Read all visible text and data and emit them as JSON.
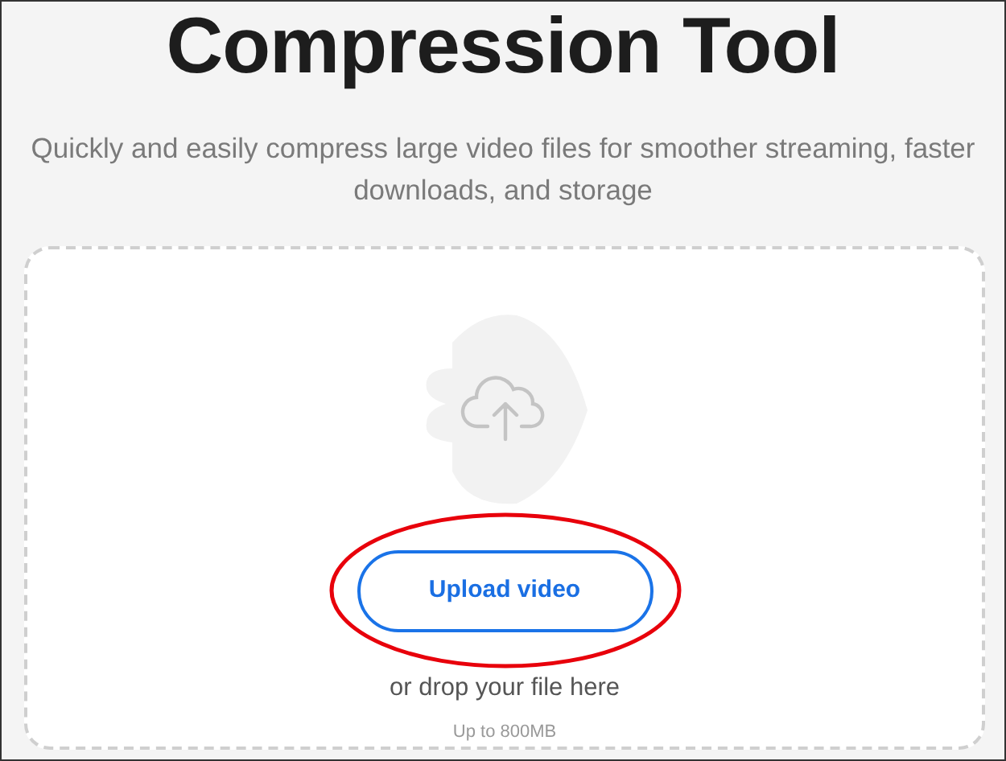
{
  "title": "Compression Tool",
  "subtitle": "Quickly and easily compress large video files for smoother streaming, faster downloads, and storage",
  "dropzone": {
    "upload_button": {
      "label": "Upload video",
      "highlighted": true
    },
    "drop_hint": "or drop your file here",
    "size_limit": "Up to 800MB"
  }
}
